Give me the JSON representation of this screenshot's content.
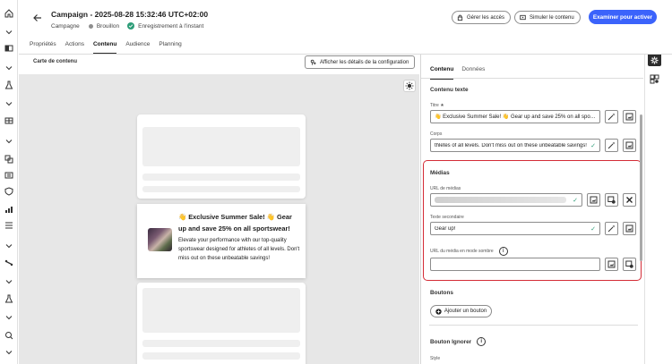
{
  "header": {
    "title": "Campaign - 2025-08-28 15:32:46 UTC+02:00",
    "type": "Campagne",
    "status": "Brouillon",
    "save_status": "Enregistrement à l'instant",
    "manage_access_label": "Gérer les accès",
    "simulate_label": "Simuler le contenu",
    "review_label": "Examiner pour activer"
  },
  "tabs": [
    "Propriétés",
    "Actions",
    "Contenu",
    "Audience",
    "Planning"
  ],
  "active_tab": "Contenu",
  "canvas": {
    "label": "Carte de contenu",
    "config_button": "Afficher les détails de la configuration",
    "notification": {
      "title": "👋 Exclusive Summer Sale! 👋 Gear up and save 25% on all sportswear!",
      "body": "Elevate your performance with our top-quality sportswear designed for athletes of all levels. Don't miss out on these unbeatable savings!"
    }
  },
  "panel": {
    "tabs": [
      "Contenu",
      "Données"
    ],
    "active_tab": "Contenu",
    "section_text": "Contenu texte",
    "title_label": "Titre ★",
    "title_value": "👋 Exclusive Summer Sale! 👋 Gear up and save 25% on all sport ...",
    "body_label": "Corps",
    "body_value": "thletes of all levels. Don't miss out on these unbeatable savings!",
    "media_section": "Médias",
    "media_url_label": "URL de médias",
    "media_url_value": "",
    "secondary_text_label": "Texte secondaire",
    "secondary_text_value": "Gear up!",
    "dark_media_label": "URL du média en mode sombre",
    "dark_media_value": "",
    "buttons_section": "Boutons",
    "add_button_label": "Ajouter un bouton",
    "ignore_buttons_section": "Bouton Ignorer",
    "style_label": "Style"
  },
  "colors": {
    "primary": "#3b63fb",
    "highlight_border": "#d42c36",
    "success": "#2d9d78"
  }
}
